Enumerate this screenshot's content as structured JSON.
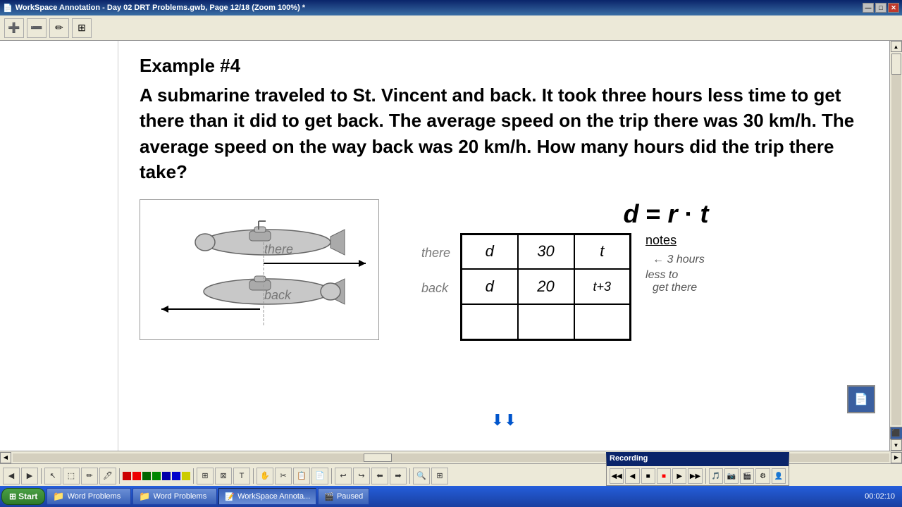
{
  "titlebar": {
    "icon": "📄",
    "title": "WorkSpace Annotation - Day 02 DRT Problems.gwb, Page 12/18 (Zoom 100%) *",
    "min": "—",
    "max": "□",
    "close": "✕"
  },
  "toolbar": {
    "buttons": [
      "+",
      "—",
      "✏",
      "⊞"
    ]
  },
  "page": {
    "example_title": "Example #4",
    "problem_text": "A submarine traveled to St. Vincent and back. It took three hours less time to get there than it did to get back.  The average speed on the trip there was 30 km/h.  The average speed on the way back was 20 km/h.  How many hours did the trip there take?"
  },
  "diagram": {
    "label_there": "there",
    "label_back": "back"
  },
  "drt_header": "d  =  r  ·  t",
  "table": {
    "rows": [
      {
        "label": "there",
        "d": "d",
        "r": "30",
        "t": "t"
      },
      {
        "label": "back",
        "d": "d",
        "r": "20",
        "t": "t+3"
      },
      {
        "label": "",
        "d": "",
        "r": "",
        "t": ""
      }
    ],
    "notes_title": "notes",
    "notes": [
      "3 hours",
      "less to",
      "get there"
    ]
  },
  "scroll_center_icon": "⬇⬇",
  "recording": {
    "title": "Recording",
    "buttons": [
      "◀◀",
      "◀",
      "■",
      "●",
      "▶",
      "▶▶"
    ],
    "red_button": "■"
  },
  "taskbar": {
    "start": "Start",
    "items": [
      {
        "label": "Word Problems",
        "icon": "📁",
        "active": false
      },
      {
        "label": "Word Problems",
        "icon": "📁",
        "active": false
      },
      {
        "label": "WorkSpace Annota...",
        "icon": "📝",
        "active": true
      },
      {
        "label": "Paused",
        "icon": "🎬",
        "active": false
      }
    ],
    "time": "00:02:10"
  }
}
